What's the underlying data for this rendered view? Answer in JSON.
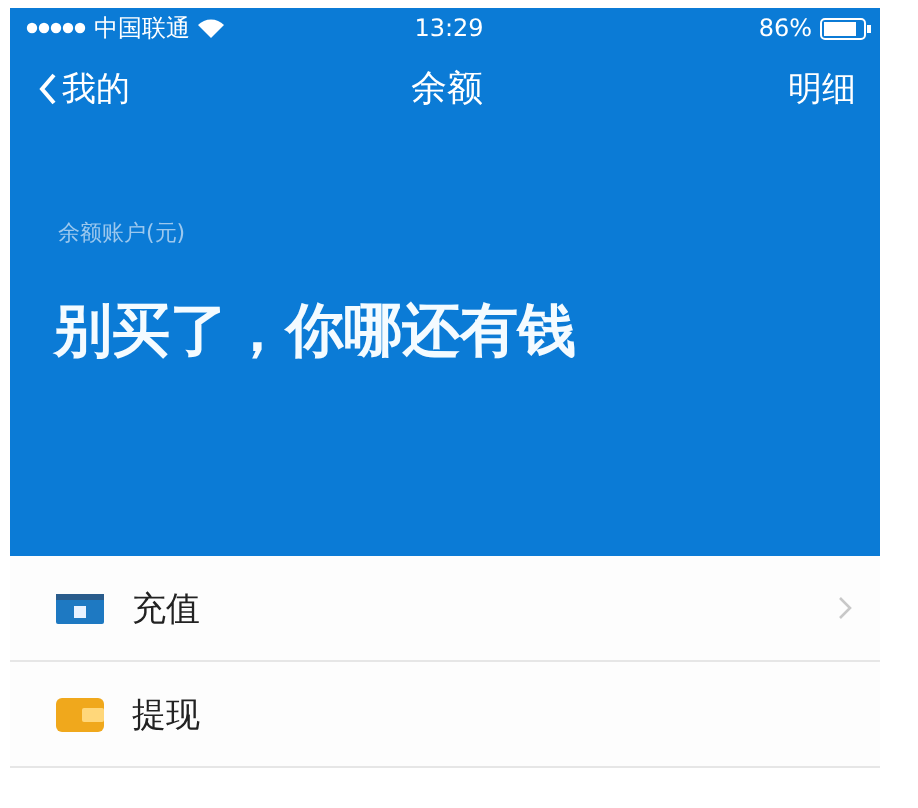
{
  "status_bar": {
    "carrier": "中国联通",
    "time": "13:29",
    "battery": "86%"
  },
  "nav": {
    "back": "我的",
    "title": "余额",
    "action": "明细"
  },
  "balance": {
    "label": "余额账户(元)",
    "amount": "别买了，你哪还有钱"
  },
  "rows": [
    {
      "kind": "recharge",
      "label": "充值",
      "chevron": true
    },
    {
      "kind": "withdraw",
      "label": "提现",
      "chevron": false
    }
  ]
}
